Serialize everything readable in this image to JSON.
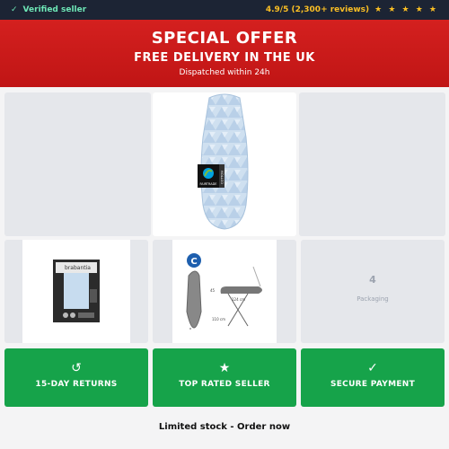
{
  "topbar": {
    "verified": "Verified seller",
    "check_icon": "✓",
    "rating": "4.9/5 (2,300+ reviews)",
    "stars": "★ ★ ★ ★ ★"
  },
  "banner": {
    "title": "SPECIAL OFFER",
    "subtitle": "FREE DELIVERY IN THE UK",
    "note": "Dispatched within 24h"
  },
  "gallery": {
    "main_image": {
      "fairtrade_text": "FAIRTRADE",
      "cotton_text": "COTTON"
    },
    "box_image": {
      "brand": "brabantia"
    },
    "size_image": {
      "size_letter": "C",
      "dims": [
        "45",
        "124 cm",
        "110 cm"
      ]
    },
    "placeholder": {
      "number": "4",
      "label": "Packaging"
    }
  },
  "badges": [
    {
      "icon": "↺",
      "label": "15-DAY RETURNS"
    },
    {
      "icon": "★",
      "label": "TOP RATED SELLER"
    },
    {
      "icon": "✓",
      "label": "SECURE PAYMENT"
    }
  ],
  "footer": {
    "text": "Limited stock - Order now"
  },
  "colors": {
    "topbar": "#1c2434",
    "banner": "#d4201f",
    "badge_green": "#16a34a",
    "accent_green": "#6ee7b7",
    "star_gold": "#fbbf24"
  }
}
